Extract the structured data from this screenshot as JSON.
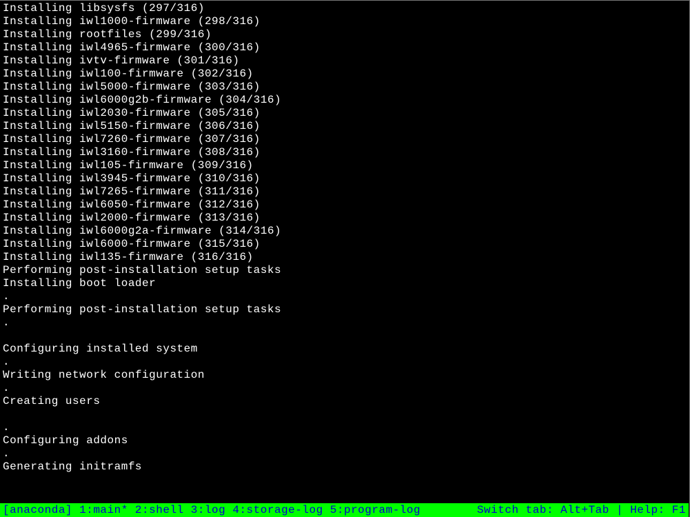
{
  "output_lines": [
    "Installing libsysfs (297/316)",
    "Installing iwl1000-firmware (298/316)",
    "Installing rootfiles (299/316)",
    "Installing iwl4965-firmware (300/316)",
    "Installing ivtv-firmware (301/316)",
    "Installing iwl100-firmware (302/316)",
    "Installing iwl5000-firmware (303/316)",
    "Installing iwl6000g2b-firmware (304/316)",
    "Installing iwl2030-firmware (305/316)",
    "Installing iwl5150-firmware (306/316)",
    "Installing iwl7260-firmware (307/316)",
    "Installing iwl3160-firmware (308/316)",
    "Installing iwl105-firmware (309/316)",
    "Installing iwl3945-firmware (310/316)",
    "Installing iwl7265-firmware (311/316)",
    "Installing iwl6050-firmware (312/316)",
    "Installing iwl2000-firmware (313/316)",
    "Installing iwl6000g2a-firmware (314/316)",
    "Installing iwl6000-firmware (315/316)",
    "Installing iwl135-firmware (316/316)",
    "Performing post-installation setup tasks",
    "Installing boot loader",
    ".",
    "Performing post-installation setup tasks",
    ".",
    "",
    "Configuring installed system",
    ".",
    "Writing network configuration",
    ".",
    "Creating users",
    "",
    ".",
    "Configuring addons",
    ".",
    "Generating initramfs",
    ""
  ],
  "status_bar": {
    "left": "[anaconda] 1:main* 2:shell  3:log  4:storage-log  5:program-log",
    "right": "Switch tab: Alt+Tab | Help: F1 "
  }
}
